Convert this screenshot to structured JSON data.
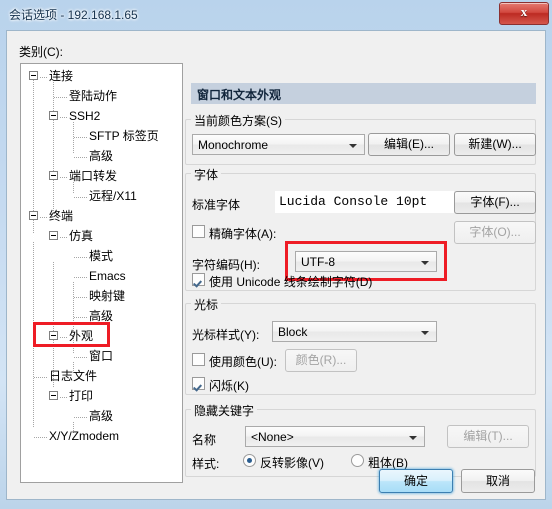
{
  "window": {
    "title": "会话选项 - 192.168.1.65",
    "close_icon": "✕",
    "close_glyph": "x"
  },
  "sidebar": {
    "label": "类别(C):",
    "items": [
      {
        "label": "连接",
        "level": 0,
        "expander": true,
        "selected": false
      },
      {
        "label": "登陆动作",
        "level": 1,
        "expander": false,
        "selected": false
      },
      {
        "label": "SSH2",
        "level": 1,
        "expander": true,
        "selected": false
      },
      {
        "label": "SFTP 标签页",
        "level": 2,
        "expander": false,
        "selected": false
      },
      {
        "label": "高级",
        "level": 2,
        "expander": false,
        "selected": false
      },
      {
        "label": "端口转发",
        "level": 1,
        "expander": true,
        "selected": false
      },
      {
        "label": "远程/X11",
        "level": 2,
        "expander": false,
        "selected": false
      },
      {
        "label": "终端",
        "level": 0,
        "expander": true,
        "selected": false
      },
      {
        "label": "仿真",
        "level": 1,
        "expander": true,
        "selected": false
      },
      {
        "label": "模式",
        "level": 2,
        "expander": false,
        "selected": false
      },
      {
        "label": "Emacs",
        "level": 2,
        "expander": false,
        "selected": false
      },
      {
        "label": "映射键",
        "level": 2,
        "expander": false,
        "selected": false
      },
      {
        "label": "高级",
        "level": 2,
        "expander": false,
        "selected": false
      },
      {
        "label": "外观",
        "level": 1,
        "expander": true,
        "selected": true
      },
      {
        "label": "窗口",
        "level": 2,
        "expander": false,
        "selected": false
      },
      {
        "label": "日志文件",
        "level": 1,
        "expander": false,
        "selected": false
      },
      {
        "label": "打印",
        "level": 1,
        "expander": true,
        "selected": false
      },
      {
        "label": "高级",
        "level": 2,
        "expander": false,
        "selected": false
      },
      {
        "label": "X/Y/Zmodem",
        "level": 1,
        "expander": false,
        "selected": false
      }
    ]
  },
  "pane": {
    "header": "窗口和文本外观",
    "color_scheme": {
      "group_title": "当前颜色方案(S)",
      "value": "Monochrome",
      "edit_button": "编辑(E)...",
      "new_button": "新建(W)..."
    },
    "font": {
      "group_title": "字体",
      "standard_font_label": "标准字体",
      "standard_font_value": "Lucida Console 10pt",
      "font_button": "字体(F)...",
      "exact_font_label": "精确字体(A):",
      "exact_font_checked": false,
      "exact_font_button": "字体(O)...",
      "encoding_label": "字符编码(H):",
      "encoding_value": "UTF-8",
      "unicode_line_label": "使用 Unicode 线条绘制字符(D)",
      "unicode_line_checked": true
    },
    "cursor": {
      "group_title": "光标",
      "style_label": "光标样式(Y):",
      "style_value": "Block",
      "use_color_label": "使用颜色(U):",
      "use_color_checked": false,
      "color_button": "颜色(R)...",
      "blink_label": "闪烁(K)",
      "blink_checked": true
    },
    "hidden_keyword": {
      "group_title": "隐藏关键字",
      "name_label": "名称",
      "name_value": "<None>",
      "edit_button": "编辑(T)...",
      "style_label": "样式:",
      "option_invert": "反转影像(V)",
      "option_bold": "粗体(B)",
      "selected_option": "invert"
    }
  },
  "footer": {
    "ok_button": "确定",
    "cancel_button": "取消"
  },
  "annotations": {
    "highlight_color": "#ee1c25",
    "boxes": [
      "tree-item-appearance",
      "encoding-combo"
    ]
  }
}
